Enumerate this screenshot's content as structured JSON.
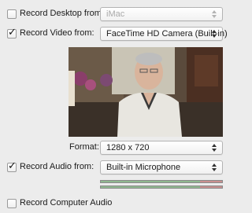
{
  "record_desktop": {
    "label": "Record Desktop from:",
    "checked": false,
    "selected": "iMac"
  },
  "record_video": {
    "label": "Record Video from:",
    "checked": true,
    "selected": "FaceTime HD Camera (Built-in)"
  },
  "format": {
    "label": "Format:",
    "selected": "1280 x 720"
  },
  "record_audio": {
    "label": "Record Audio from:",
    "checked": true,
    "selected": "Built-in Microphone",
    "meters": [
      0.82,
      0.82
    ]
  },
  "record_computer_audio": {
    "label": "Record Computer Audio",
    "checked": false
  },
  "colors": {
    "window_bg": "#ececec",
    "meter_green": "#8fb78f",
    "meter_red": "#c98f8f"
  }
}
